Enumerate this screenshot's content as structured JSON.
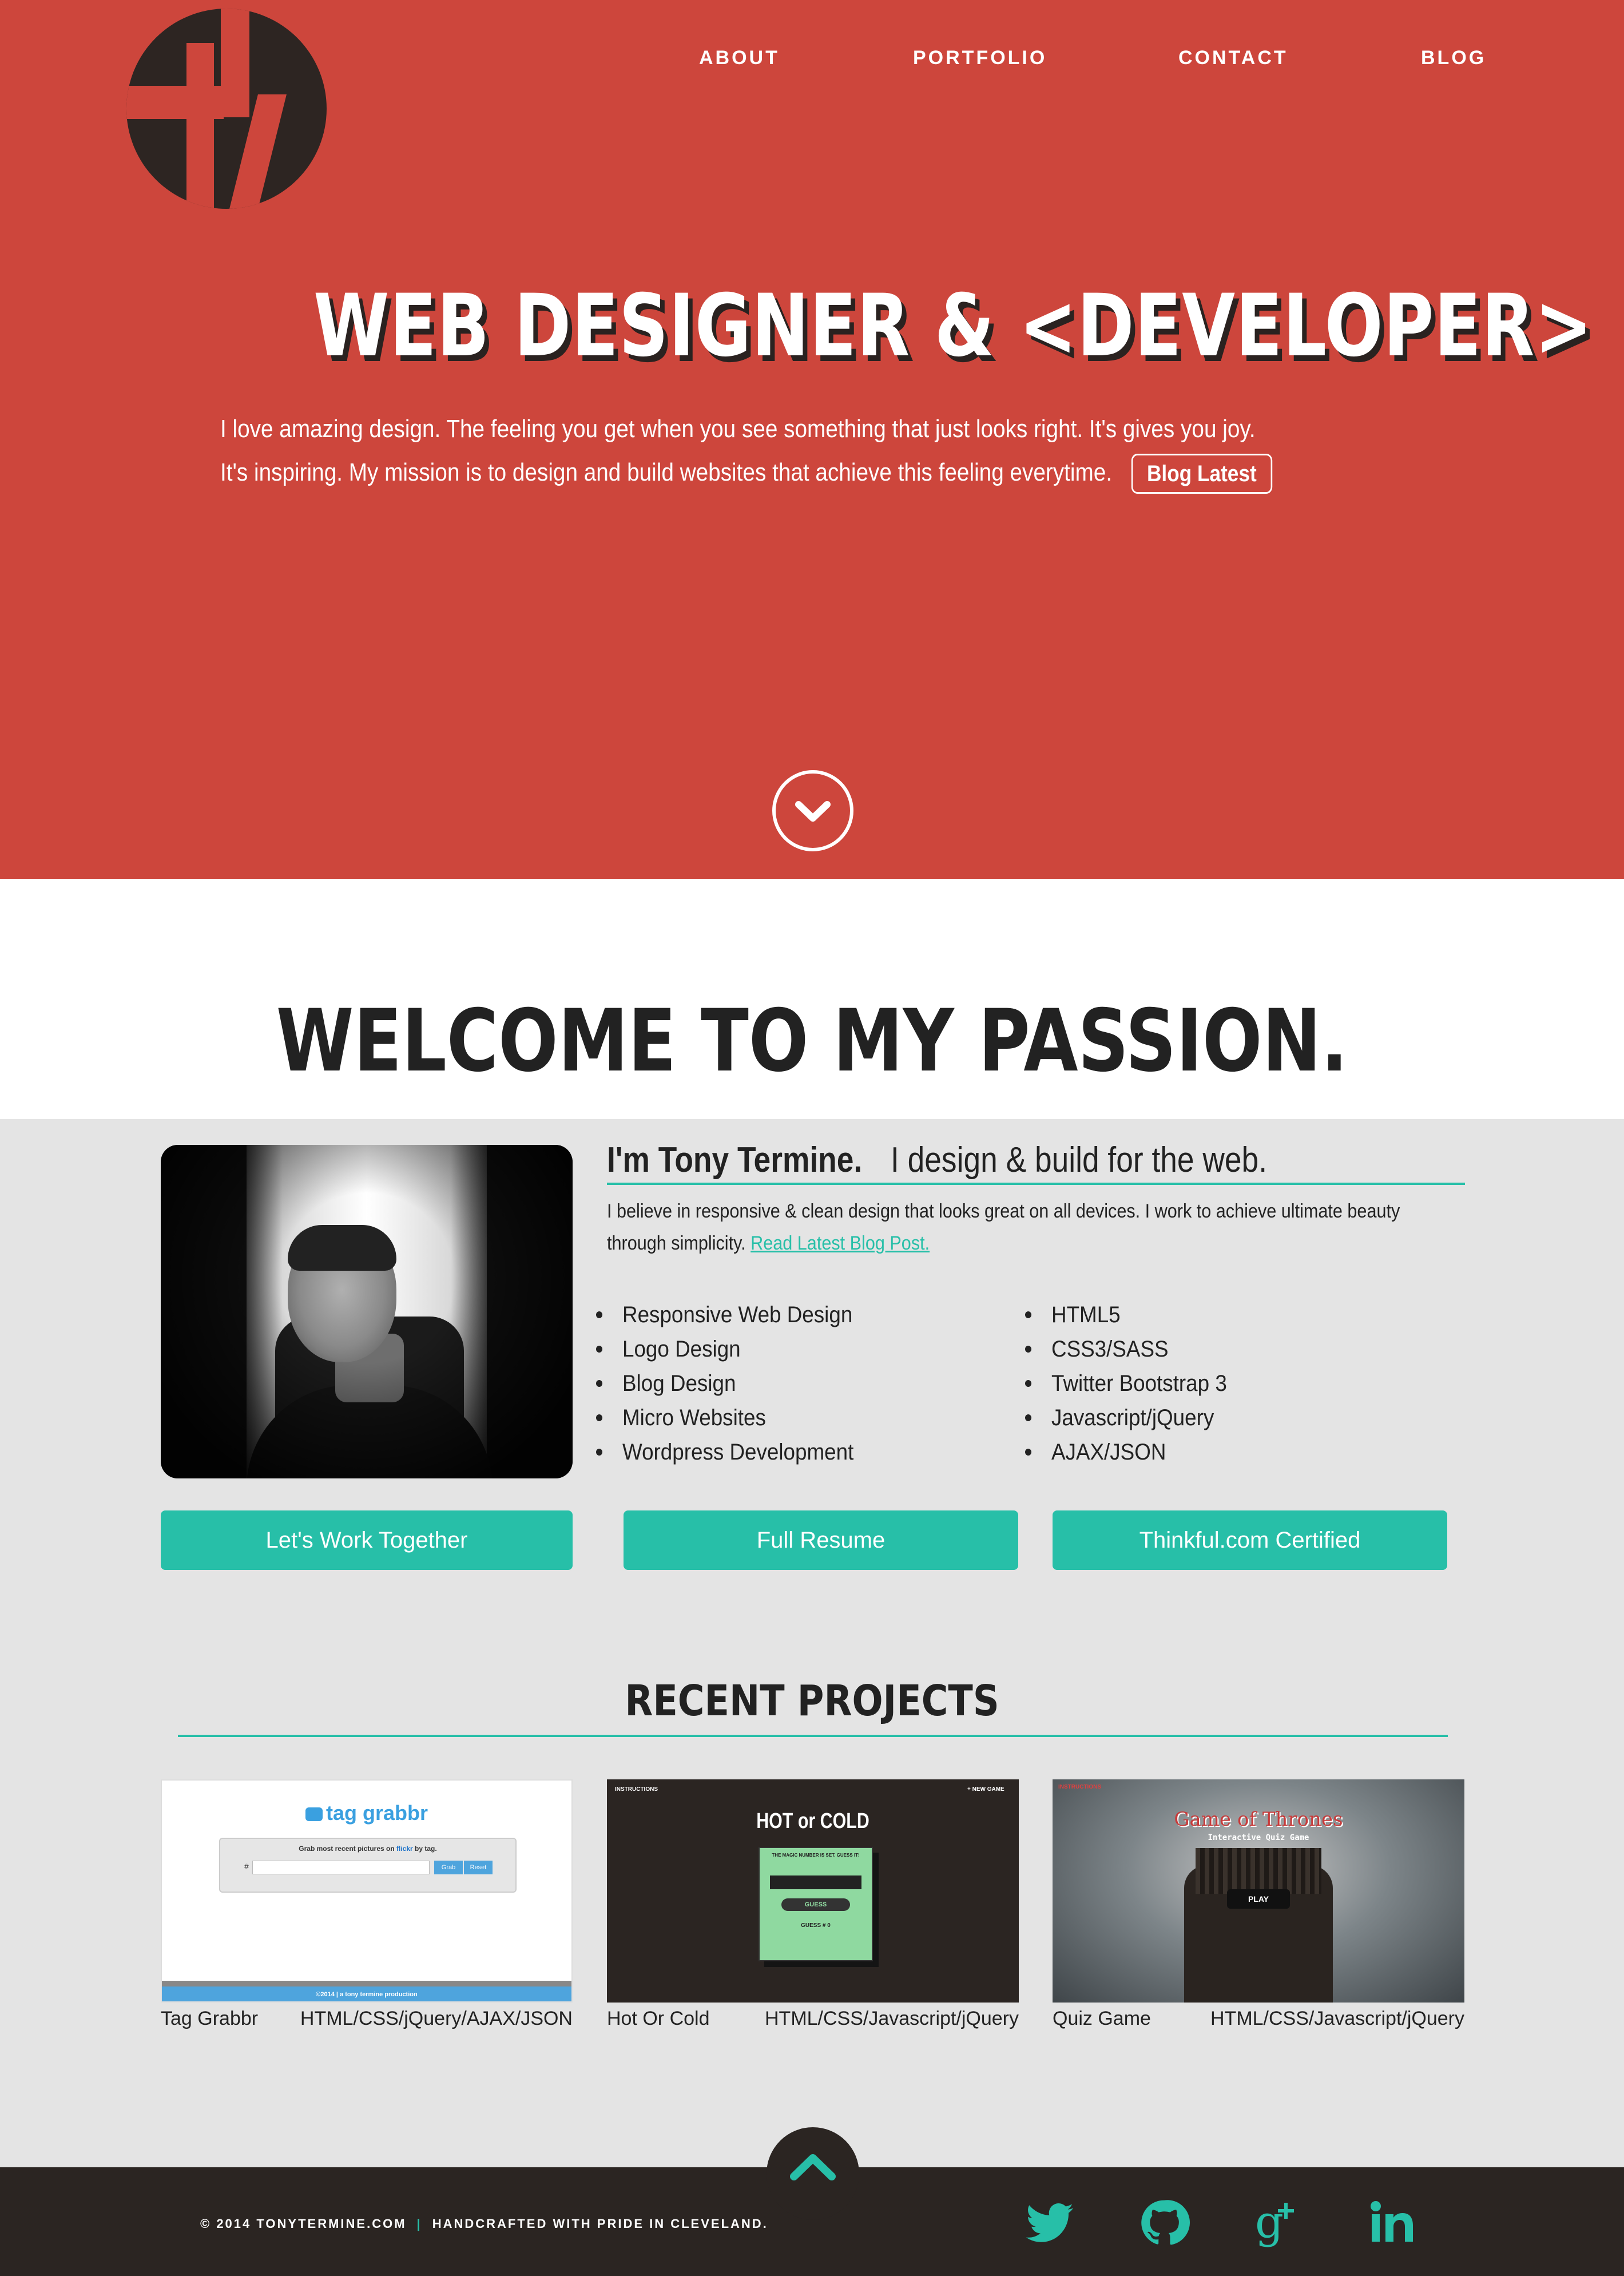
{
  "colors": {
    "hero_red": "#cd463c",
    "dark": "#2b2522",
    "teal": "#27bfa8",
    "page_bg": "#e4e4e4",
    "white": "#ffffff"
  },
  "nav": {
    "about": "ABOUT",
    "portfolio": "PORTFOLIO",
    "contact": "CONTACT",
    "blog": "BLOG"
  },
  "hero": {
    "title": "WEB DESIGNER & <DEVELOPER>",
    "text": "I love amazing design.  The feeling you get when you see something that just looks right.  It's gives you joy.  It's inspiring.  My mission is to design and build websites that achieve this feeling everytime.",
    "button": "Blog Latest",
    "scroll_icon": "chevron-down-icon"
  },
  "welcome": {
    "title": "WELCOME TO MY PASSION."
  },
  "about": {
    "name": "I'm Tony Termine.",
    "tagline": "I design & build for the web.",
    "text": "I believe in responsive & clean design that looks great on all devices. I work to achieve ultimate beauty through simplicity.",
    "link": "Read Latest Blog Post.",
    "skills_left": [
      "Responsive Web Design",
      "Logo Design",
      "Blog Design",
      "Micro Websites",
      "Wordpress Development"
    ],
    "skills_right": [
      "HTML5",
      "CSS3/SASS",
      "Twitter Bootstrap 3",
      "Javascript/jQuery",
      "AJAX/JSON"
    ]
  },
  "cta": {
    "work": "Let's Work Together",
    "resume": "Full Resume",
    "thinkful": "Thinkful.com Certified"
  },
  "projects": {
    "title": "RECENT PROJECTS",
    "items": [
      {
        "name": "Tag Grabbr",
        "tech": "HTML/CSS/jQuery/AJAX/JSON",
        "brand": "tag grabbr",
        "prompt": "Grab most recent pictures on flickr by tag.",
        "prompt_pre": "Grab most recent pictures on ",
        "prompt_brand": "flickr",
        "prompt_post": " by tag.",
        "hash": "#",
        "grab": "Grab",
        "reset": "Reset",
        "footer": "©2014  |  a tony termine production"
      },
      {
        "name": "Hot Or Cold",
        "tech": "HTML/CSS/Javascript/jQuery",
        "instructions": "INSTRUCTIONS",
        "new_game": "+ NEW GAME",
        "title": "HOT or COLD",
        "status": "THE MAGIC NUMBER IS SET.  GUESS IT!",
        "guess": "GUESS",
        "count": "GUESS # 0"
      },
      {
        "name": "Quiz Game",
        "tech": "HTML/CSS/Javascript/jQuery",
        "instructions": "INSTRUCTIONS",
        "title": "Game of Thrones",
        "subtitle": "Interactive Quiz Game",
        "play": "PLAY"
      }
    ]
  },
  "footer": {
    "copyright": "© 2014 TONYTERMINE.COM",
    "separator": "|",
    "tagline": "HANDCRAFTED WITH PRIDE IN CLEVELAND."
  },
  "social": [
    "twitter-icon",
    "github-icon",
    "google-plus-icon",
    "linkedin-icon"
  ]
}
